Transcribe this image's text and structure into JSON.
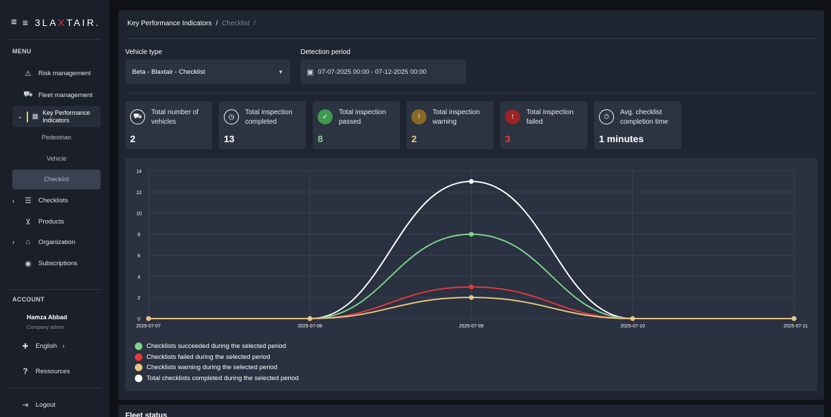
{
  "app": {
    "logo_left": "≡ 3LA",
    "logo_x": "X",
    "logo_right": "TAIR."
  },
  "sidebar": {
    "menu_heading": "MENU",
    "items": [
      {
        "label": "Risk management",
        "icon": "warning-triangle-icon"
      },
      {
        "label": "Fleet management",
        "icon": "truck-icon"
      },
      {
        "label": "Key Performance Indicators",
        "icon": "grid-icon"
      },
      {
        "label": "Pedestrian"
      },
      {
        "label": "Vehicle"
      },
      {
        "label": "Checklist"
      },
      {
        "label": "Checklists",
        "icon": "checklist-icon"
      },
      {
        "label": "Products",
        "icon": "cart-icon"
      },
      {
        "label": "Organization",
        "icon": "organization-icon"
      },
      {
        "label": "Subscriptions",
        "icon": "subscription-icon"
      }
    ],
    "account_heading": "ACCOUNT",
    "user": {
      "name": "Hamza Abbad",
      "role": "Company admin"
    },
    "language": "English",
    "resources": "Ressources",
    "logout": "Logout"
  },
  "breadcrumb": {
    "root": "Key Performance Indicators",
    "sep": "/",
    "current": "Checklist",
    "trail": "/"
  },
  "filters": {
    "vehicle_type_label": "Vehicle type",
    "vehicle_type_value": "Beta - Blaxtair - Checklist",
    "detection_label": "Detection period",
    "detection_value": "07-07-2025 00:00 - 07-12-2025 00:00"
  },
  "kpis": [
    {
      "label": "Total number of vehicles",
      "value": "2",
      "icon": "vehicle-icon",
      "color": "#ffffff"
    },
    {
      "label": "Total inspection completed",
      "value": "13",
      "icon": "clock-icon",
      "color": "#ffffff"
    },
    {
      "label": "Total inspection passed",
      "value": "8",
      "icon": "check-icon",
      "color": "#7fd38d"
    },
    {
      "label": "Total inspection warning",
      "value": "2",
      "icon": "exclamation-icon",
      "color": "#e6c883"
    },
    {
      "label": "Total inspection failed",
      "value": "3",
      "icon": "error-icon",
      "color": "#e23b3b"
    },
    {
      "label": "Avg. checklist completion time",
      "value": "1 minutes",
      "icon": "stopwatch-icon",
      "color": "#ffffff"
    }
  ],
  "chart_data": {
    "type": "line",
    "x": [
      "2025-07-07",
      "2025-07-08",
      "2025-07-09",
      "2025-07-10",
      "2025-07-11"
    ],
    "yticks": [
      0,
      2,
      4,
      6,
      8,
      10,
      12,
      14
    ],
    "ylim": [
      0,
      14
    ],
    "grid": true,
    "legend_position": "bottom-left",
    "series": [
      {
        "name": "Checklists succeeded during the selected period",
        "color": "#7fd38d",
        "values": [
          0,
          0,
          8,
          0,
          0
        ]
      },
      {
        "name": "Checklists failed during the selected period",
        "color": "#e23b3b",
        "values": [
          0,
          0,
          3,
          0,
          0
        ]
      },
      {
        "name": "Checklists warning during the selected period",
        "color": "#e6c883",
        "values": [
          0,
          0,
          2,
          0,
          0
        ]
      },
      {
        "name": "Total checklists completed during the selected period",
        "color": "#ffffff",
        "values": [
          0,
          0,
          13,
          0,
          0
        ]
      }
    ]
  },
  "fleet": {
    "title": "Fleet status"
  }
}
